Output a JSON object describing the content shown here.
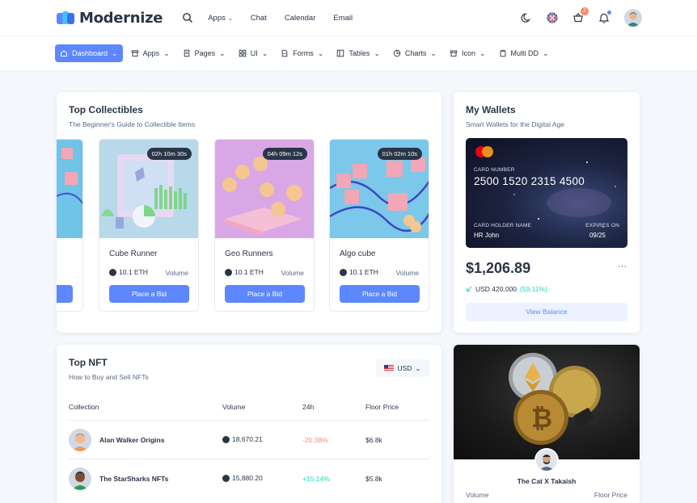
{
  "brand": {
    "name": "Modernize"
  },
  "topnav": [
    "Apps",
    "Chat",
    "Calendar",
    "Email"
  ],
  "notifications": {
    "cart_count": "2"
  },
  "menu": [
    {
      "label": "Dashboard",
      "icon": "home-icon"
    },
    {
      "label": "Apps",
      "icon": "archive-icon"
    },
    {
      "label": "Pages",
      "icon": "files-icon"
    },
    {
      "label": "UI",
      "icon": "grid-icon"
    },
    {
      "label": "Forms",
      "icon": "file-text-icon"
    },
    {
      "label": "Tables",
      "icon": "layout-icon"
    },
    {
      "label": "Charts",
      "icon": "pie-chart-icon"
    },
    {
      "label": "Icon",
      "icon": "box-icon"
    },
    {
      "label": "Multi DD",
      "icon": "clipboard-icon"
    }
  ],
  "collectibles": {
    "title": "Top Collectibles",
    "subtitle": "The Beginner's Guide to Collectible Items",
    "partial_vol": "e",
    "items": [
      {
        "timer": "02h 10m 30s",
        "name": "Cube Runner",
        "eth": "10.1 ETH",
        "volume": "Volume",
        "button": "Place a Bid"
      },
      {
        "timer": "04h 09m 12s",
        "name": "Geo Runners",
        "eth": "10.1 ETH",
        "volume": "Volume",
        "button": "Place a Bid"
      },
      {
        "timer": "01h 02m 10s",
        "name": "Algo cube",
        "eth": "10.1 ETH",
        "volume": "Volume",
        "button": "Place a Bid"
      }
    ]
  },
  "wallet": {
    "title": "My Wallets",
    "subtitle": "Smart Wallets for the Digital Age",
    "card_number_label": "CARD NUMBER",
    "card_number": "2500 1520 2315 4500",
    "holder_label": "CARD HOLDER NAME",
    "holder": "HR John",
    "expires_label": "EXPIRES ON",
    "expires": "09/25",
    "balance": "$1,206.89",
    "more": "···",
    "usd": "USD 420,000",
    "pct": "(59,11%)",
    "button": "View Balance"
  },
  "top_nft": {
    "title": "Top NFT",
    "subtitle": "How to Buy and Sell NFTs",
    "currency": "USD",
    "headers": [
      "Collection",
      "Volume",
      "24h",
      "Floor Price"
    ],
    "rows": [
      {
        "name": "Alan Walker Origins",
        "volume": "18,670.21",
        "change": "-20.38%",
        "floor": "$6.8k",
        "trend": "neg"
      },
      {
        "name": "The StarSharks NFTs",
        "volume": "15,880.20",
        "change": "+15.14%",
        "floor": "$5.8k",
        "trend": "pos"
      }
    ]
  },
  "cat_card": {
    "name": "The Cat X Takaish",
    "volume_label": "Volume",
    "floor_label": "Floor Price"
  }
}
